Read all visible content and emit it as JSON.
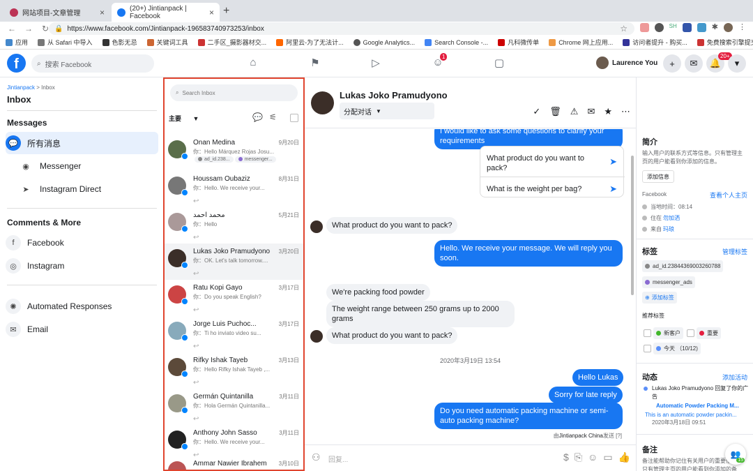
{
  "browser": {
    "tabs": [
      {
        "title": "网站项目-文章管理",
        "color": "#c44"
      },
      {
        "title": "(20+) Jintianpack | Facebook",
        "color": "#1877f2"
      }
    ],
    "url": "https://www.facebook.com/Jintianpack-196583740973253/inbox",
    "bookmarks": [
      "应用",
      "从 Safari 中导入",
      "色影无忌",
      "关键词工具",
      "二手区_摄影器材交...",
      "阿里云-为了无法计...",
      "Google Analytics...",
      "Search Console -...",
      "凡科微传单",
      "Chrome 网上应用...",
      "访问者提升 - 购买...",
      "免费搜索引擎提交..."
    ],
    "ext_label": "SH"
  },
  "fb": {
    "logo": "f",
    "search_placeholder": "搜索 Facebook",
    "nav_badge": "1",
    "user_name": "Laurence You",
    "notif_badge": "20+"
  },
  "left": {
    "breadcrumb_root": "Jintianpack",
    "breadcrumb_sep": " > ",
    "breadcrumb_current": "Inbox",
    "title": "Inbox",
    "messages_section": "Messages",
    "items": [
      "所有消息",
      "Messenger",
      "Instagram Direct"
    ],
    "comments_section": "Comments & More",
    "comments_items": [
      "Facebook",
      "Instagram"
    ],
    "other_items": [
      "Automated Responses",
      "Email"
    ]
  },
  "list": {
    "search_placeholder": "Search Inbox",
    "filter": "主要",
    "conversations": [
      {
        "name": "Onan Medina",
        "date": "9月20日",
        "preview": "你：Hello Márquez Rojas Josu...",
        "tags": [
          "ad_id.238...",
          "messenger..."
        ]
      },
      {
        "name": "Houssam Oubaziz",
        "date": "8月31日",
        "preview": "你：Hello. We receive your..."
      },
      {
        "name": "محمد احمد",
        "date": "5月21日",
        "preview": "你：Hello"
      },
      {
        "name": "Lukas Joko Pramudyono",
        "date": "3月20日",
        "preview": "你：OK. Let's talk tomorrow...."
      },
      {
        "name": "Ratu Kopi Gayo",
        "date": "3月17日",
        "preview": "你：Do you speak English?"
      },
      {
        "name": "Jorge Luis Puchoc...",
        "date": "3月17日",
        "preview": "你：Ti ho inviato video su..."
      },
      {
        "name": "Rifky Ishak Tayeb",
        "date": "3月13日",
        "preview": "你：Hello Rifky Ishak Tayeb ,..."
      },
      {
        "name": "Germán Quintanilla",
        "date": "3月11日",
        "preview": "你：Hola Germán Quintanilla..."
      },
      {
        "name": "Anthony John Sasso",
        "date": "3月11日",
        "preview": "你：Hello. We receive your..."
      },
      {
        "name": "Ammar Nawier Ibrahem",
        "date": "3月10日",
        "preview": ""
      }
    ]
  },
  "chat": {
    "name": "Lukas Joko Pramudyono",
    "assign": "分配对话",
    "top_bubble": "I would like to ask some questions to clarify your requirements",
    "quick_replies": [
      "What product do you want to pack?",
      "What is the weight per bag?"
    ],
    "m1": "What product do you want to pack?",
    "m2": "Hello. We receive your message. We will reply you soon.",
    "m3": "We're packing food powder",
    "m4": "The weight range between 250 grams up to 2000 grams",
    "m5": "What product do you want to pack?",
    "timestamp": "2020年3月19日 13:54",
    "m6": "Hello Lukas",
    "m7": "Sorry for late reply",
    "m8": "Do you need automatic packing machine or semi-auto packing machine?",
    "sent_by_prefix": "由",
    "sent_by_page": "Jintianpack China",
    "sent_by_suffix": "发送 [?]",
    "compose_placeholder": "回复..."
  },
  "right": {
    "intro_title": "简介",
    "intro_text": "输入用户的联系方式等信息。只有管理主页的用户能看到你添加的信息。",
    "add_info": "添加信息",
    "source": "Facebook",
    "view_profile": "查看个人主页",
    "local_time": "当地时间：08:14",
    "lives_prefix": "住在",
    "lives_place": "勿加洒",
    "from_prefix": "来自",
    "from_place": "玛琅",
    "tags_title": "标签",
    "manage_tags": "管理标签",
    "tags": [
      "ad_id.23844369003260788",
      "messenger_ads"
    ],
    "add_tag": "添加标签",
    "suggested_title": "推荐标签",
    "suggested": [
      "新客户",
      "重要",
      "今天 （10/12)"
    ],
    "activity_title": "动态",
    "add_activity": "添加活动",
    "activity_text": "Lukas Joko Pramudyono 回复了你的广告",
    "activity_ad": "Automatic Powder Packing M...",
    "activity_ad_sub": "This is an automatic powder packin...",
    "activity_date": "2020年3月18日 09:51",
    "notes_title": "备注",
    "notes_text": "备注能帮助你记住有关用户的重要信息。只有管理主页的用户能看到你添加的备注。",
    "float_badge": "15"
  }
}
